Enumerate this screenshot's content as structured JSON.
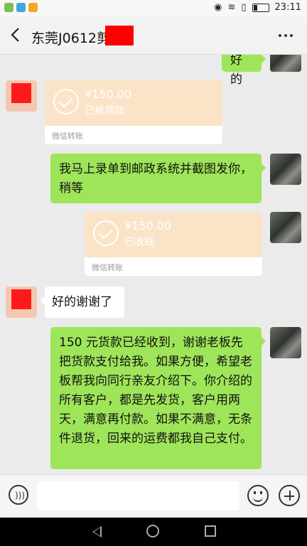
{
  "status": {
    "time": "23:11"
  },
  "header": {
    "title": "东莞J0612剪",
    "more_icon": "more-icon",
    "back_icon": "back-arrow-icon"
  },
  "messages": {
    "top_partial": {
      "text": "好的"
    },
    "transfer1": {
      "amount": "¥150.00",
      "status": "已被领取",
      "footer": "微信转账"
    },
    "msg2": {
      "text": "我马上录单到邮政系统并截图发你，稍等"
    },
    "transfer2": {
      "amount": "¥150.00",
      "status": "已收钱",
      "footer": "微信转账"
    },
    "msg3": {
      "text": "好的谢谢了"
    },
    "msg4": {
      "text": "150 元货款已经收到，谢谢老板先把货款支付给我。如果方便，希望老板帮我向同行亲友介绍下。你介绍的所有客户，都是先发货，客户用两天，满意再付款。如果不满意，无条件退货，回来的运费都我自己支付。"
    }
  },
  "input": {
    "value": ""
  },
  "colors": {
    "green_bubble": "#9fe55a",
    "transfer_bg": "#fbe3c8",
    "redaction": "#ff0000"
  }
}
